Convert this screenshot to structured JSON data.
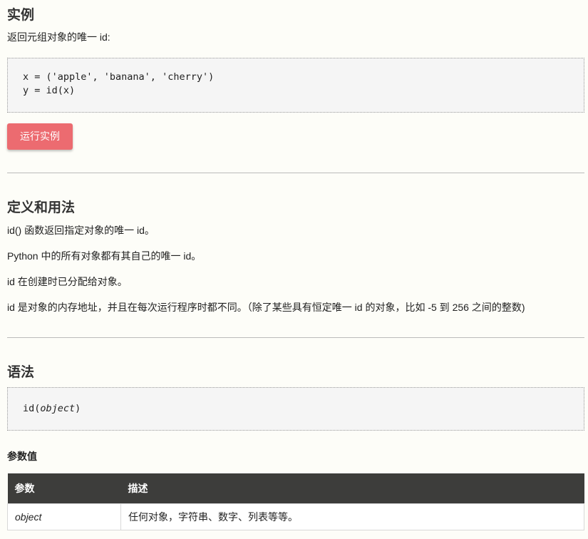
{
  "example": {
    "heading": "实例",
    "intro": "返回元组对象的唯一 id:",
    "code_lines": [
      "x = ('apple', 'banana', 'cherry')",
      "y = id(x)"
    ],
    "run_button_label": "运行实例"
  },
  "definition": {
    "heading": "定义和用法",
    "paragraphs": [
      "id() 函数返回指定对象的唯一 id。",
      "Python 中的所有对象都有其自己的唯一 id。",
      "id 在创建时已分配给对象。",
      "id 是对象的内存地址，并且在每次运行程序时都不同。（除了某些具有恒定唯一 id 的对象，比如 -5 到 256 之间的整数)"
    ]
  },
  "syntax": {
    "heading": "语法",
    "code_prefix": "id(",
    "code_param": "object",
    "code_suffix": ")"
  },
  "params": {
    "heading": "参数值",
    "columns": [
      "参数",
      "描述"
    ],
    "rows": [
      {
        "name": "object",
        "description": "任何对象，字符串、数字、列表等等。"
      }
    ]
  },
  "colors": {
    "background": "#fdfdf8",
    "button": "#ec6b70",
    "table_header": "#3d3d3b"
  }
}
